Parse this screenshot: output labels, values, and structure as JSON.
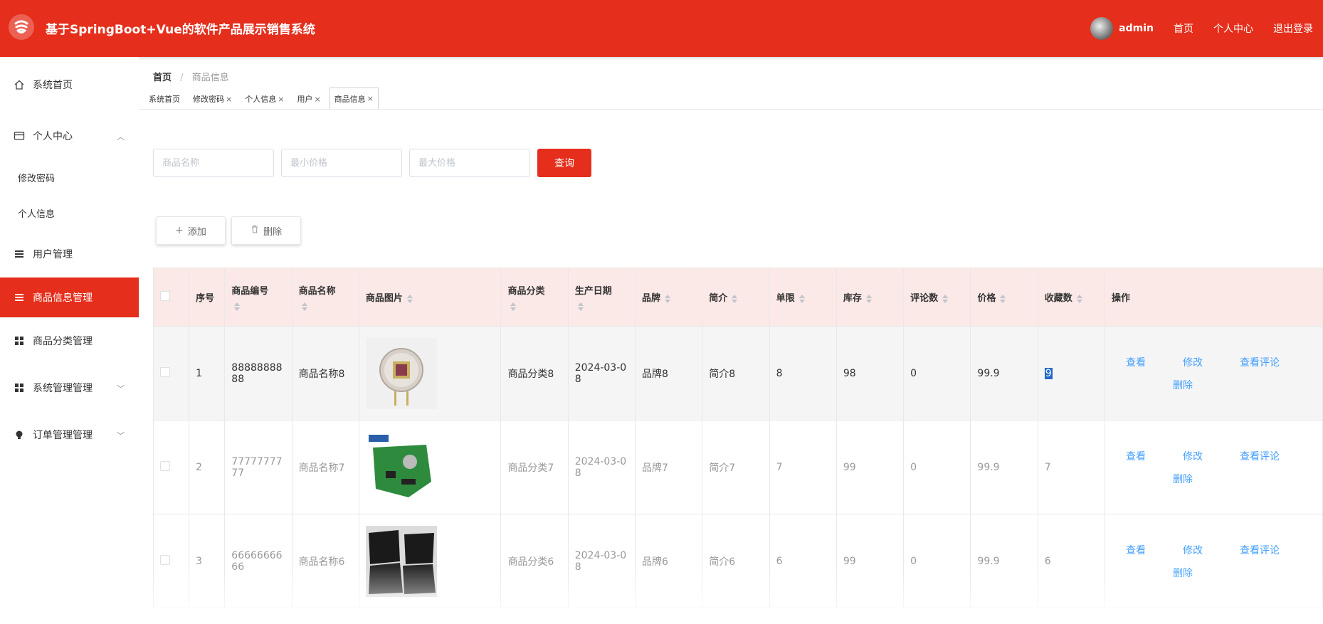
{
  "header": {
    "title": "基于SpringBoot+Vue的软件产品展示销售系统",
    "username": "admin",
    "links": [
      "首页",
      "个人中心",
      "退出登录"
    ]
  },
  "sidebar": {
    "items": [
      {
        "label": "系统首页",
        "icon": "home-icon"
      },
      {
        "label": "个人中心",
        "icon": "card-icon",
        "expanded": true
      },
      {
        "label": "修改密码"
      },
      {
        "label": "个人信息"
      },
      {
        "label": "用户管理",
        "icon": "list-icon"
      },
      {
        "label": "商品信息管理",
        "icon": "list-icon",
        "active": true
      },
      {
        "label": "商品分类管理",
        "icon": "grid-icon"
      },
      {
        "label": "系统管理管理",
        "icon": "grid-icon"
      },
      {
        "label": "订单管理管理",
        "icon": "bulb-icon"
      }
    ]
  },
  "breadcrumb": {
    "home": "首页",
    "sep": "/",
    "current": "商品信息"
  },
  "tags": [
    {
      "label": "系统首页"
    },
    {
      "label": "修改密码"
    },
    {
      "label": "个人信息"
    },
    {
      "label": "用户"
    },
    {
      "label": "商品信息",
      "active": true
    }
  ],
  "search": {
    "name_placeholder": "商品名称",
    "min_price_placeholder": "最小价格",
    "max_price_placeholder": "最大价格",
    "query_label": "查询"
  },
  "actions": {
    "add_label": "添加",
    "delete_label": "删除"
  },
  "table": {
    "headers": [
      "序号",
      "商品编号",
      "商品名称",
      "商品图片",
      "商品分类",
      "生产日期",
      "品牌",
      "简介",
      "单限",
      "库存",
      "评论数",
      "价格",
      "收藏数",
      "操作"
    ],
    "rows": [
      {
        "no": "1",
        "code": "8888888888",
        "name": "商品名称8",
        "category": "商品分类8",
        "date": "2024-03-08",
        "brand": "品牌8",
        "intro": "简介8",
        "limit": "8",
        "stock": "98",
        "comments": "0",
        "price": "99.9",
        "favorites": "9"
      },
      {
        "no": "2",
        "code": "7777777777",
        "name": "商品名称7",
        "category": "商品分类7",
        "date": "2024-03-08",
        "brand": "品牌7",
        "intro": "简介7",
        "limit": "7",
        "stock": "99",
        "comments": "0",
        "price": "99.9",
        "favorites": "7"
      },
      {
        "no": "3",
        "code": "6666666666",
        "name": "商品名称6",
        "category": "商品分类6",
        "date": "2024-03-08",
        "brand": "品牌6",
        "intro": "简介6",
        "limit": "6",
        "stock": "99",
        "comments": "0",
        "price": "99.9",
        "favorites": "6"
      }
    ],
    "ops": {
      "view": "查看",
      "edit": "修改",
      "view_comments": "查看评论",
      "delete": "删除"
    }
  },
  "colors": {
    "brand": "#e52e1b",
    "header_row": "#fbe9e7",
    "link": "#409eff"
  }
}
